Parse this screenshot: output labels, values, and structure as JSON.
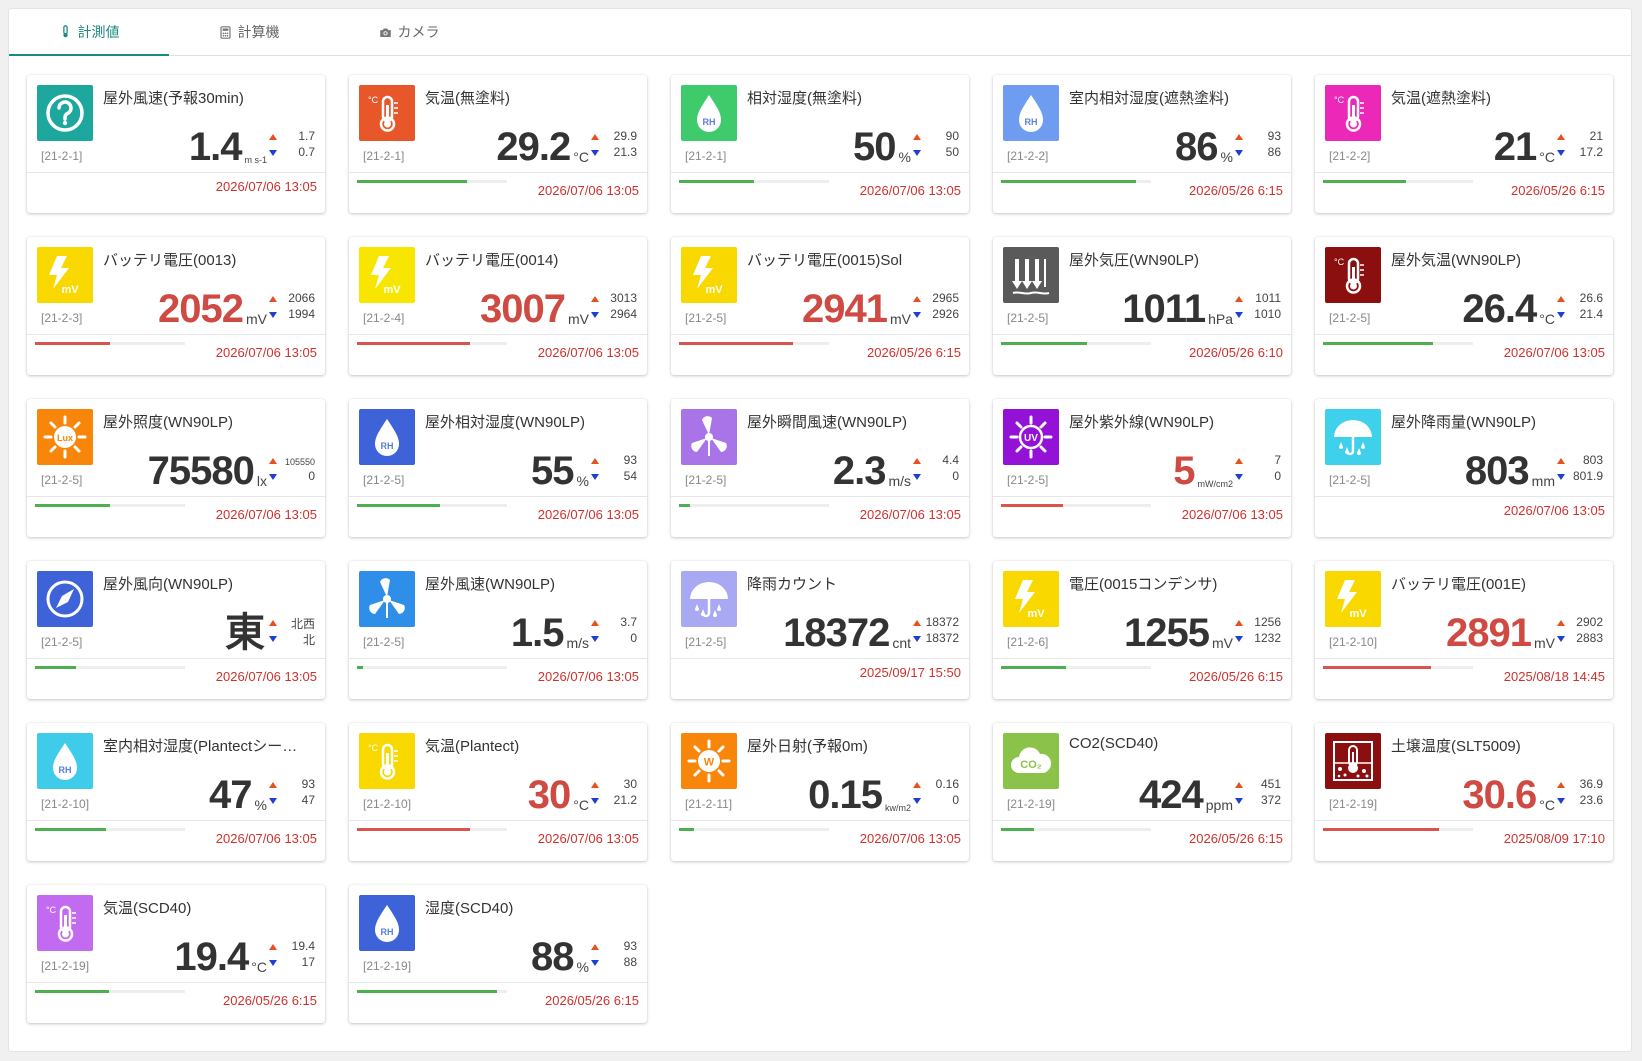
{
  "tabs": [
    {
      "label": "計測値",
      "icon": "thermometer-icon",
      "active": true
    },
    {
      "label": "計算機",
      "icon": "calculator-icon",
      "active": false
    },
    {
      "label": "カメラ",
      "icon": "camera-icon",
      "active": false
    }
  ],
  "colors": {
    "accent": "#1a8a83",
    "alert": "#d0312d",
    "bar_green": "#4caf50",
    "bar_red": "#d9534f",
    "up_arrow": "#e8501f",
    "down_arrow": "#1e3fd6"
  },
  "cards": [
    {
      "title": "屋外風速(予報30min)",
      "loc": "[21-2-1]",
      "value": "1.4",
      "unit": "m s-1",
      "max": "1.7",
      "min": "0.7",
      "time": "2026/07/06 13:05",
      "icon": "question-icon",
      "icon_color": "#1ea79d",
      "value_color": "#333",
      "bar": null
    },
    {
      "title": "気温(無塗料)",
      "loc": "[21-2-1]",
      "value": "29.2",
      "unit": "°C",
      "max": "29.9",
      "min": "21.3",
      "time": "2026/07/06 13:05",
      "icon": "thermometer-icon",
      "icon_color": "#e8572a",
      "value_color": "#333",
      "bar": {
        "level": 0.73,
        "color": "green"
      }
    },
    {
      "title": "相対湿度(無塗料)",
      "loc": "[21-2-1]",
      "value": "50",
      "unit": "%",
      "max": "90",
      "min": "50",
      "time": "2026/07/06 13:05",
      "icon": "humidity-drop-icon",
      "icon_color": "#3fca6b",
      "value_color": "#333",
      "bar": {
        "level": 0.5,
        "color": "green"
      }
    },
    {
      "title": "室内相対湿度(遮熱塗料)",
      "loc": "[21-2-2]",
      "value": "86",
      "unit": "%",
      "max": "93",
      "min": "86",
      "time": "2026/05/26 6:15",
      "icon": "humidity-drop-icon",
      "icon_color": "#6e9cf0",
      "value_color": "#333",
      "bar": {
        "level": 0.9,
        "color": "green"
      }
    },
    {
      "title": "気温(遮熱塗料)",
      "loc": "[21-2-2]",
      "value": "21",
      "unit": "°C",
      "max": "21",
      "min": "17.2",
      "time": "2026/05/26 6:15",
      "icon": "thermometer-icon",
      "icon_color": "#ec28b8",
      "value_color": "#333",
      "bar": {
        "level": 0.55,
        "color": "green"
      }
    },
    {
      "title": "バッテリ電圧(0013)",
      "loc": "[21-2-3]",
      "value": "2052",
      "unit": "mV",
      "max": "2066",
      "min": "1994",
      "time": "2026/07/06 13:05",
      "icon": "battery-voltage-icon",
      "icon_color": "#f9d800",
      "value_color": "#cf4a42",
      "bar": {
        "level": 0.5,
        "color": "red"
      }
    },
    {
      "title": "バッテリ電圧(0014)",
      "loc": "[21-2-4]",
      "value": "3007",
      "unit": "mV",
      "max": "3013",
      "min": "2964",
      "time": "2026/07/06 13:05",
      "icon": "battery-voltage-icon",
      "icon_color": "#f9e600",
      "value_color": "#cf4a42",
      "bar": {
        "level": 0.75,
        "color": "red"
      }
    },
    {
      "title": "バッテリ電圧(0015)Sol",
      "loc": "[21-2-5]",
      "value": "2941",
      "unit": "mV",
      "max": "2965",
      "min": "2926",
      "time": "2026/05/26 6:15",
      "icon": "battery-voltage-icon",
      "icon_color": "#f9d800",
      "value_color": "#cf4a42",
      "bar": {
        "level": 0.76,
        "color": "red"
      }
    },
    {
      "title": "屋外気圧(WN90LP)",
      "loc": "[21-2-5]",
      "value": "1011",
      "unit": "hPa",
      "max": "1011",
      "min": "1010",
      "time": "2026/05/26 6:10",
      "icon": "pressure-icon",
      "icon_color": "#5a5a5a",
      "value_color": "#333",
      "bar": {
        "level": 0.57,
        "color": "green"
      }
    },
    {
      "title": "屋外気温(WN90LP)",
      "loc": "[21-2-5]",
      "value": "26.4",
      "unit": "°C",
      "max": "26.6",
      "min": "21.4",
      "time": "2026/07/06 13:05",
      "icon": "thermometer-icon",
      "icon_color": "#8b0f0f",
      "value_color": "#333",
      "bar": {
        "level": 0.73,
        "color": "green"
      }
    },
    {
      "title": "屋外照度(WN90LP)",
      "loc": "[21-2-5]",
      "value": "75580",
      "unit": "lx",
      "max": "105550",
      "min": "0",
      "time": "2026/07/06 13:05",
      "icon": "lux-sun-icon",
      "icon_color": "#f7860b",
      "value_color": "#333",
      "bar": {
        "level": 0.5,
        "color": "green"
      }
    },
    {
      "title": "屋外相対湿度(WN90LP)",
      "loc": "[21-2-5]",
      "value": "55",
      "unit": "%",
      "max": "93",
      "min": "54",
      "time": "2026/07/06 13:05",
      "icon": "humidity-drop-icon",
      "icon_color": "#3e63d9",
      "value_color": "#333",
      "bar": {
        "level": 0.55,
        "color": "green"
      }
    },
    {
      "title": "屋外瞬間風速(WN90LP)",
      "loc": "[21-2-5]",
      "value": "2.3",
      "unit": "m/s",
      "max": "4.4",
      "min": "0",
      "time": "2026/07/06 13:05",
      "icon": "windmill-icon",
      "icon_color": "#a974e8",
      "value_color": "#333",
      "bar": {
        "level": 0.07,
        "color": "green"
      }
    },
    {
      "title": "屋外紫外線(WN90LP)",
      "loc": "[21-2-5]",
      "value": "5",
      "unit": "mW/cm2",
      "max": "7",
      "min": "0",
      "time": "2026/07/06 13:05",
      "icon": "uv-sun-icon",
      "icon_color": "#9411d6",
      "value_color": "#cf4a42",
      "bar": {
        "level": 0.41,
        "color": "red"
      }
    },
    {
      "title": "屋外降雨量(WN90LP)",
      "loc": "[21-2-5]",
      "value": "803",
      "unit": "mm",
      "max": "803",
      "min": "801.9",
      "time": "2026/07/06 13:05",
      "icon": "umbrella-rain-icon",
      "icon_color": "#3fd0ec",
      "value_color": "#333",
      "bar": null
    },
    {
      "title": "屋外風向(WN90LP)",
      "loc": "[21-2-5]",
      "value": "東",
      "unit": "",
      "max": "北西",
      "min": "北",
      "time": "2026/07/06 13:05",
      "icon": "compass-icon",
      "icon_color": "#3e63d9",
      "value_color": "#333",
      "bar": {
        "level": 0.27,
        "color": "green"
      }
    },
    {
      "title": "屋外風速(WN90LP)",
      "loc": "[21-2-5]",
      "value": "1.5",
      "unit": "m/s",
      "max": "3.7",
      "min": "0",
      "time": "2026/07/06 13:05",
      "icon": "windmill-icon",
      "icon_color": "#2f8fe8",
      "value_color": "#333",
      "bar": {
        "level": 0.04,
        "color": "green"
      }
    },
    {
      "title": "降雨カウント",
      "loc": "[21-2-5]",
      "value": "18372",
      "unit": "cnt",
      "max": "18372",
      "min": "18372",
      "time": "2025/09/17 15:50",
      "icon": "umbrella-rain-icon",
      "icon_color": "#a8a8f3",
      "value_color": "#333",
      "bar": null
    },
    {
      "title": "電圧(0015コンデンサ)",
      "loc": "[21-2-6]",
      "value": "1255",
      "unit": "mV",
      "max": "1256",
      "min": "1232",
      "time": "2026/05/26 6:15",
      "icon": "battery-voltage-icon",
      "icon_color": "#f9d800",
      "value_color": "#333",
      "bar": {
        "level": 0.43,
        "color": "green"
      }
    },
    {
      "title": "バッテリ電圧(001E)",
      "loc": "[21-2-10]",
      "value": "2891",
      "unit": "mV",
      "max": "2902",
      "min": "2883",
      "time": "2025/08/18 14:45",
      "icon": "battery-voltage-icon",
      "icon_color": "#f9d800",
      "value_color": "#cf4a42",
      "bar": {
        "level": 0.72,
        "color": "red"
      }
    },
    {
      "title": "室内相対湿度(Plantectシー…",
      "loc": "[21-2-10]",
      "value": "47",
      "unit": "%",
      "max": "93",
      "min": "47",
      "time": "2026/07/06 13:05",
      "icon": "humidity-drop-icon",
      "icon_color": "#3fcbea",
      "value_color": "#333",
      "bar": {
        "level": 0.47,
        "color": "green"
      }
    },
    {
      "title": "気温(Plantect)",
      "loc": "[21-2-10]",
      "value": "30",
      "unit": "°C",
      "max": "30",
      "min": "21.2",
      "time": "2026/07/06 13:05",
      "icon": "thermometer-icon",
      "icon_color": "#f9d800",
      "value_color": "#cf4a42",
      "bar": {
        "level": 0.75,
        "color": "red"
      }
    },
    {
      "title": "屋外日射(予報0m)",
      "loc": "[21-2-11]",
      "value": "0.15",
      "unit": "kw/m2",
      "max": "0.16",
      "min": "0",
      "time": "2026/07/06 13:05",
      "icon": "solar-w-icon",
      "icon_color": "#f7860b",
      "value_color": "#333",
      "bar": {
        "level": 0.1,
        "color": "green"
      }
    },
    {
      "title": "CO2(SCD40)",
      "loc": "[21-2-19]",
      "value": "424",
      "unit": "ppm",
      "max": "451",
      "min": "372",
      "time": "2026/05/26 6:15",
      "icon": "co2-cloud-icon",
      "icon_color": "#8bc34a",
      "value_color": "#333",
      "bar": {
        "level": 0.22,
        "color": "green"
      }
    },
    {
      "title": "土壌温度(SLT5009)",
      "loc": "[21-2-19]",
      "value": "30.6",
      "unit": "°C",
      "max": "36.9",
      "min": "23.6",
      "time": "2025/08/09 17:10",
      "icon": "soil-thermometer-icon",
      "icon_color": "#8b0f0f",
      "value_color": "#cf4a42",
      "bar": {
        "level": 0.77,
        "color": "red"
      }
    },
    {
      "title": "気温(SCD40)",
      "loc": "[21-2-19]",
      "value": "19.4",
      "unit": "°C",
      "max": "19.4",
      "min": "17",
      "time": "2026/05/26 6:15",
      "icon": "thermometer-icon",
      "icon_color": "#c26bf0",
      "value_color": "#333",
      "bar": {
        "level": 0.49,
        "color": "green"
      }
    },
    {
      "title": "湿度(SCD40)",
      "loc": "[21-2-19]",
      "value": "88",
      "unit": "%",
      "max": "93",
      "min": "88",
      "time": "2026/05/26 6:15",
      "icon": "humidity-drop-icon",
      "icon_color": "#3e63d9",
      "value_color": "#333",
      "bar": {
        "level": 0.93,
        "color": "green"
      }
    }
  ]
}
